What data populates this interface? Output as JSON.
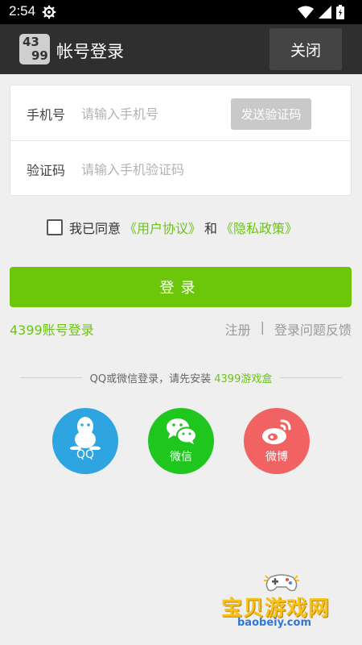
{
  "status_bar": {
    "time": "2:54",
    "icons": [
      "settings-icon",
      "wifi-icon",
      "signal-icon",
      "battery-icon"
    ]
  },
  "app_bar": {
    "logo_top": "43",
    "logo_bottom": "99",
    "title": "帐号登录",
    "close_label": "关闭"
  },
  "form": {
    "phone_label": "手机号",
    "phone_placeholder": "请输入手机号",
    "send_code_label": "发送验证码",
    "code_label": "验证码",
    "code_placeholder": "请输入手机验证码"
  },
  "agreement": {
    "prefix": "我已同意",
    "user_agreement": "《用户协议》",
    "and": "和",
    "privacy_policy": "《隐私政策》"
  },
  "login_button": "登录",
  "links": {
    "account_login": "4399账号登录",
    "register": "注册",
    "separator": "|",
    "feedback": "登录问题反馈"
  },
  "third_party": {
    "hint_prefix": "QQ或微信登录，请先安装",
    "hint_app": "4399游戏盒",
    "qq": "QQ",
    "wechat": "微信",
    "weibo": "微博"
  },
  "watermark": {
    "text": "宝贝游戏网",
    "url": "baobeiy.com"
  },
  "colors": {
    "accent": "#6cc70a",
    "qq": "#2ea5e0",
    "wechat": "#1ec61d",
    "weibo": "#f06362",
    "app_bar": "#2f2f2f"
  }
}
